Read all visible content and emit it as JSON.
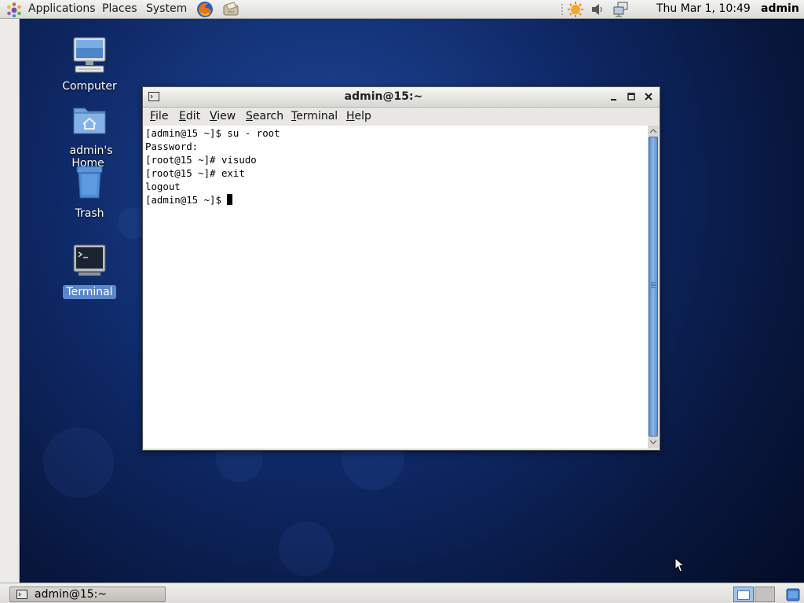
{
  "top_panel": {
    "menus": [
      "Applications",
      "Places",
      "System"
    ],
    "clock": "Thu Mar  1, 10:49",
    "user": "admin"
  },
  "desktop": {
    "icons": [
      {
        "label": "Computer"
      },
      {
        "label": "admin's Home"
      },
      {
        "label": "Trash"
      },
      {
        "label": "Terminal",
        "selected": true
      }
    ]
  },
  "terminal": {
    "title": "admin@15:~",
    "menus": [
      {
        "accel": "F",
        "rest": "ile"
      },
      {
        "accel": "E",
        "rest": "dit"
      },
      {
        "accel": "V",
        "rest": "iew"
      },
      {
        "accel": "S",
        "rest": "earch"
      },
      {
        "accel": "T",
        "rest": "erminal"
      },
      {
        "accel": "H",
        "rest": "elp"
      }
    ],
    "lines": [
      "[admin@15 ~]$ su - root",
      "Password:",
      "[root@15 ~]# visudo",
      "[root@15 ~]# exit",
      "logout",
      "[admin@15 ~]$ "
    ]
  },
  "taskbar": {
    "window_label": "admin@15:~"
  },
  "colors": {
    "desktop": "#0e2865",
    "selection": "#5b87c9",
    "scroll_thumb": "#5b8fd0"
  }
}
